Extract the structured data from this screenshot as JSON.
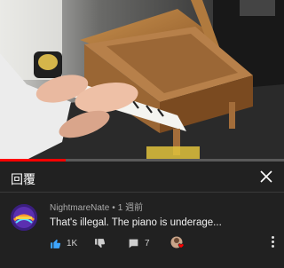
{
  "video": {
    "progress_fraction": 0.23
  },
  "panel": {
    "title": "回覆"
  },
  "comment": {
    "author": "NightmareNate",
    "separator": "•",
    "time_ago": "1 週前",
    "text": "That's illegal. The piano is underage...",
    "like_count": "1K",
    "reply_count": "7"
  },
  "colors": {
    "background": "#212121",
    "progress": "#ff0000",
    "like_accent": "#3ea6ff",
    "heart": "#ff0000"
  },
  "icons": {
    "close": "close-icon",
    "like": "thumb-up-icon",
    "dislike": "thumb-down-icon",
    "reply": "comment-icon",
    "creator_heart": "creator-heart-icon",
    "more": "more-vert-icon"
  }
}
